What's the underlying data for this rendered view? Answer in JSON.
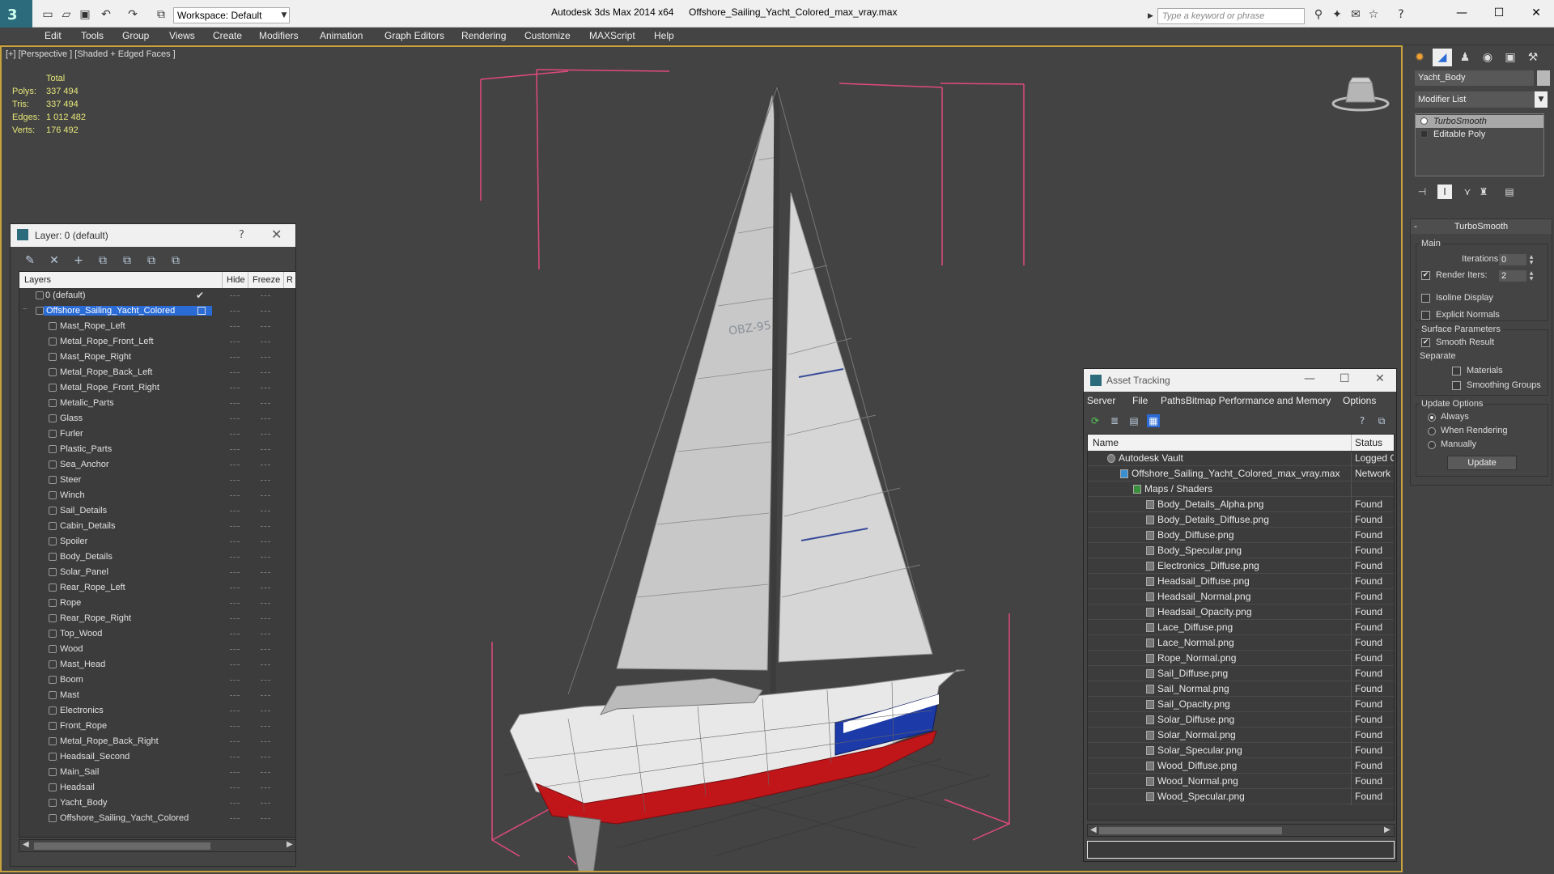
{
  "titlebar": {
    "workspace": "Workspace: Default",
    "app_title": "Autodesk 3ds Max  2014 x64",
    "file_title": "Offshore_Sailing_Yacht_Colored_max_vray.max",
    "search_placeholder": "Type a keyword or phrase"
  },
  "menu": [
    "Edit",
    "Tools",
    "Group",
    "Views",
    "Create",
    "Modifiers",
    "Animation",
    "Graph Editors",
    "Rendering",
    "Customize",
    "MAXScript",
    "Help"
  ],
  "viewport": {
    "label": "[+] [Perspective ] [Shaded + Edged Faces ]",
    "stats": {
      "header": "Total",
      "rows": [
        {
          "label": "Polys:",
          "value": "337 494"
        },
        {
          "label": "Tris:",
          "value": "337 494"
        },
        {
          "label": "Edges:",
          "value": "1 012 482"
        },
        {
          "label": "Verts:",
          "value": "176 492"
        }
      ]
    },
    "sail_number": "OBZ-95"
  },
  "layer_panel": {
    "title": "Layer: 0 (default)",
    "help": "?",
    "columns": {
      "layers": "Layers",
      "hide": "Hide",
      "freeze": "Freeze",
      "render": "R"
    },
    "default_layer": "0 (default)",
    "selected_layer": "Offshore_Sailing_Yacht_Colored",
    "objects": [
      "Mast_Rope_Left",
      "Metal_Rope_Front_Left",
      "Mast_Rope_Right",
      "Metal_Rope_Back_Left",
      "Metal_Rope_Front_Right",
      "Metalic_Parts",
      "Glass",
      "Furler",
      "Plastic_Parts",
      "Sea_Anchor",
      "Steer",
      "Winch",
      "Sail_Details",
      "Cabin_Details",
      "Spoiler",
      "Body_Details",
      "Solar_Panel",
      "Rear_Rope_Left",
      "Rope",
      "Rear_Rope_Right",
      "Top_Wood",
      "Wood",
      "Mast_Head",
      "Boom",
      "Mast",
      "Electronics",
      "Front_Rope",
      "Metal_Rope_Back_Right",
      "Headsail_Second",
      "Main_Sail",
      "Headsail",
      "Yacht_Body",
      "Offshore_Sailing_Yacht_Colored"
    ]
  },
  "asset_panel": {
    "title": "Asset Tracking",
    "menu": [
      "Server",
      "File",
      "Paths",
      "Bitmap Performance and Memory",
      "Options"
    ],
    "columns": {
      "name": "Name",
      "status": "Status"
    },
    "vault": {
      "name": "Autodesk Vault",
      "status": "Logged O"
    },
    "file": {
      "name": "Offshore_Sailing_Yacht_Colored_max_vray.max",
      "status": "Network F"
    },
    "maps_folder": "Maps / Shaders",
    "maps": [
      {
        "name": "Body_Details_Alpha.png",
        "status": "Found"
      },
      {
        "name": "Body_Details_Diffuse.png",
        "status": "Found"
      },
      {
        "name": "Body_Diffuse.png",
        "status": "Found"
      },
      {
        "name": "Body_Specular.png",
        "status": "Found"
      },
      {
        "name": "Electronics_Diffuse.png",
        "status": "Found"
      },
      {
        "name": "Headsail_Diffuse.png",
        "status": "Found"
      },
      {
        "name": "Headsail_Normal.png",
        "status": "Found"
      },
      {
        "name": "Headsail_Opacity.png",
        "status": "Found"
      },
      {
        "name": "Lace_Diffuse.png",
        "status": "Found"
      },
      {
        "name": "Lace_Normal.png",
        "status": "Found"
      },
      {
        "name": "Rope_Normal.png",
        "status": "Found"
      },
      {
        "name": "Sail_Diffuse.png",
        "status": "Found"
      },
      {
        "name": "Sail_Normal.png",
        "status": "Found"
      },
      {
        "name": "Sail_Opacity.png",
        "status": "Found"
      },
      {
        "name": "Solar_Diffuse.png",
        "status": "Found"
      },
      {
        "name": "Solar_Normal.png",
        "status": "Found"
      },
      {
        "name": "Solar_Specular.png",
        "status": "Found"
      },
      {
        "name": "Wood_Diffuse.png",
        "status": "Found"
      },
      {
        "name": "Wood_Normal.png",
        "status": "Found"
      },
      {
        "name": "Wood_Specular.png",
        "status": "Found"
      }
    ]
  },
  "command_panel": {
    "object_name": "Yacht_Body",
    "modifier_list": "Modifier List",
    "stack": [
      "TurboSmooth",
      "Editable Poly"
    ],
    "rollout_title": "TurboSmooth",
    "main_group": "Main",
    "iterations_label": "Iterations:",
    "iterations_value": "0",
    "render_iters_label": "Render Iters:",
    "render_iters_value": "2",
    "render_iters_checked": true,
    "isoline_label": "Isoline Display",
    "explicit_normals_label": "Explicit Normals",
    "surface_group": "Surface Parameters",
    "smooth_result_label": "Smooth Result",
    "separate_label": "Separate",
    "materials_label": "Materials",
    "smoothing_groups_label": "Smoothing Groups",
    "update_group": "Update Options",
    "always_label": "Always",
    "when_rendering_label": "When Rendering",
    "manually_label": "Manually",
    "update_button": "Update"
  },
  "colors": {
    "accent_select": "#2a6bd6",
    "viewport_border": "#c8a23c",
    "stats_text": "#e6e67a",
    "hull_red": "#c0161a",
    "hull_blue": "#1c3aa8",
    "bbox_pink": "#e04a7a"
  }
}
